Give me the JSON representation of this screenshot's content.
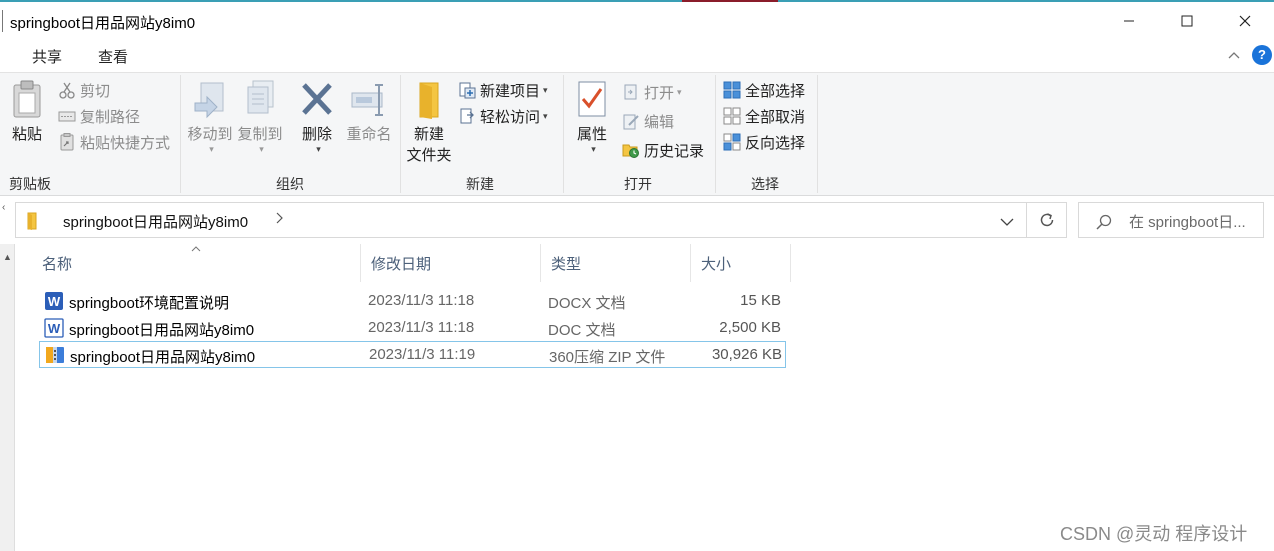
{
  "window": {
    "title": "springboot日用品网站y8im0"
  },
  "menu": {
    "tabs": [
      "共享",
      "查看"
    ]
  },
  "ribbon": {
    "clipboard": {
      "label": "剪贴板",
      "paste": "粘贴",
      "cut": "剪切",
      "copy_path": "复制路径",
      "paste_shortcut": "粘贴快捷方式"
    },
    "organize": {
      "label": "组织",
      "move_to": "移动到",
      "copy_to": "复制到",
      "delete": "删除",
      "rename": "重命名"
    },
    "new": {
      "label": "新建",
      "new_folder_line1": "新建",
      "new_folder_line2": "文件夹",
      "new_item": "新建项目",
      "easy_access": "轻松访问"
    },
    "open": {
      "label": "打开",
      "properties": "属性",
      "open": "打开",
      "edit": "编辑",
      "history": "历史记录"
    },
    "select": {
      "label": "选择",
      "select_all": "全部选择",
      "select_none": "全部取消",
      "invert": "反向选择"
    }
  },
  "address": {
    "path": "springboot日用品网站y8im0",
    "search_placeholder": "在 springboot日..."
  },
  "columns": {
    "name": "名称",
    "modified": "修改日期",
    "type": "类型",
    "size": "大小"
  },
  "files": [
    {
      "name": "springboot环境配置说明",
      "modified": "2023/11/3 11:18",
      "type": "DOCX 文档",
      "size": "15 KB",
      "icon": "word-docx-icon"
    },
    {
      "name": "springboot日用品网站y8im0",
      "modified": "2023/11/3 11:18",
      "type": "DOC 文档",
      "size": "2,500 KB",
      "icon": "word-doc-icon"
    },
    {
      "name": "springboot日用品网站y8im0",
      "modified": "2023/11/3 11:19",
      "type": "360压缩 ZIP 文件",
      "size": "30,926 KB",
      "icon": "zip-archive-icon"
    }
  ],
  "watermark": "CSDN @灵动 程序设计",
  "colors": {
    "accent": "#1a73d9",
    "selection_border": "#85c5e9",
    "word_blue": "#2b5eb8"
  }
}
